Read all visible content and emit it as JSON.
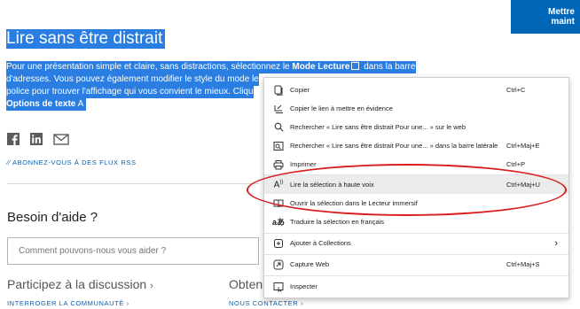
{
  "cta": {
    "line1": "Mettre",
    "line2": "maint"
  },
  "article": {
    "title": "Lire sans être distrait",
    "para": {
      "l1a": "Pour une présentation simple et claire, sans distractions, sélectionnez le ",
      "l1b": "Mode Lecture",
      "l1c": " dans la barre",
      "l2": "d'adresses. Vous pouvez également modifier le style du mode le",
      "l3": "police pour trouver l'affichage qui vous convient le mieux. Cliqu",
      "l4a": "Options de texte",
      "l4b": "A"
    },
    "rss": "ABONNEZ-VOUS À DES FLUX RSS"
  },
  "help": {
    "heading": "Besoin d'aide ?",
    "placeholder": "Comment pouvons-nous vous aider ?",
    "discussion": "Participez à la discussion",
    "obtain": "Obten",
    "ask_link": "INTERROGER LA COMMUNAUTÉ",
    "contact_link": "NOUS CONTACTER"
  },
  "menu": {
    "items": [
      {
        "label": "Copier",
        "shortcut": "Ctrl+C",
        "icon": "copy-icon"
      },
      {
        "label": "Copier le lien à mettre en évidence",
        "shortcut": "",
        "icon": "link-highlight-icon"
      },
      {
        "label": "Rechercher « Lire sans être distrait Pour une... » sur le web",
        "shortcut": "",
        "icon": "search-icon"
      },
      {
        "label": "Rechercher « Lire sans être distrait Pour une... » dans la barre latérale",
        "shortcut": "Ctrl+Maj+E",
        "icon": "sidebar-search-icon"
      },
      {
        "label": "Imprimer",
        "shortcut": "Ctrl+P",
        "icon": "print-icon"
      },
      {
        "label": "Lire la sélection à haute voix",
        "shortcut": "Ctrl+Maj+U",
        "icon": "read-aloud-icon"
      },
      {
        "label": "Ouvrir la sélection dans le Lecteur immersif",
        "shortcut": "",
        "icon": "immersive-reader-icon"
      },
      {
        "label": "Traduire la sélection en français",
        "shortcut": "",
        "icon": "translate-icon"
      },
      {
        "label": "Ajouter à Collections",
        "shortcut": "›",
        "icon": "collections-icon"
      },
      {
        "label": "Capture Web",
        "shortcut": "Ctrl+Maj+S",
        "icon": "web-capture-icon"
      },
      {
        "label": "Inspecter",
        "shortcut": "",
        "icon": "inspect-icon"
      }
    ]
  },
  "colors": {
    "selection": "#2a7de1",
    "accent": "#0067b8",
    "annotation": "#d71d1d"
  }
}
